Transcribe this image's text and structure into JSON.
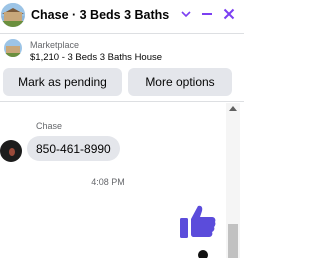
{
  "header": {
    "title": "Chase · 3 Beds 3 Baths Ho…",
    "accent_color": "#7b3ff2",
    "icons": [
      "chevron-down-icon",
      "minimize-icon",
      "close-icon"
    ]
  },
  "listing": {
    "label": "Marketplace",
    "price_title": "$1,210 - 3 Beds 3 Baths House",
    "buttons": {
      "mark_pending": "Mark as pending",
      "more_options": "More options"
    }
  },
  "conversation": {
    "sender": "Chase",
    "message": "850-461-8990",
    "timestamp": "4:08 PM",
    "reaction_icon": "thumbs-up-icon",
    "reaction_color": "#5b4cdb",
    "bubble_color": "#e4e6eb"
  }
}
